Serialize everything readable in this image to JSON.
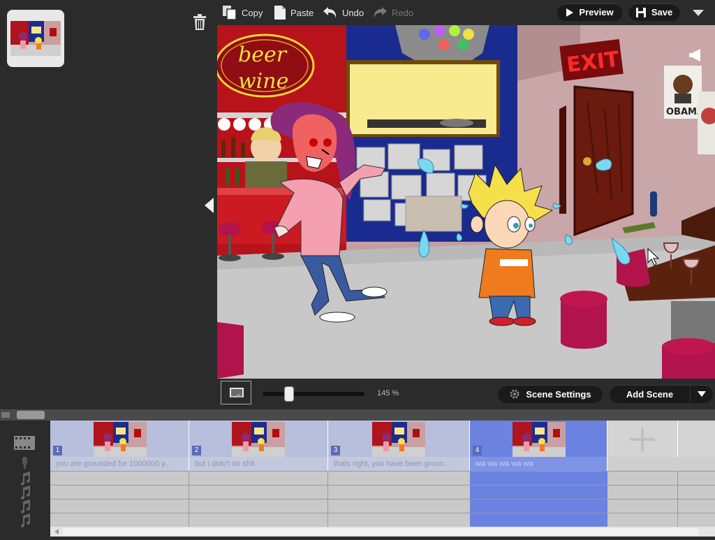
{
  "toolbar": {
    "copy_label": "Copy",
    "paste_label": "Paste",
    "undo_label": "Undo",
    "redo_label": "Redo",
    "preview_label": "Preview",
    "save_label": "Save"
  },
  "stage": {
    "bar_sign_line1": "beer",
    "bar_sign_line2": "wine",
    "exit_sign": "EXIT",
    "poster_text": "OBAMA"
  },
  "stagebar": {
    "zoom_label": "145 %",
    "zoom_level_fraction": 0.25,
    "scene_settings_label": "Scene Settings",
    "add_scene_label": "Add Scene"
  },
  "timeline": {
    "scenes": [
      {
        "number": "1",
        "caption": "you are grounded for 1000000 y...",
        "selected": false
      },
      {
        "number": "2",
        "caption": "but i didn't do shit",
        "selected": false
      },
      {
        "number": "3",
        "caption": "thats right, you have been groun...",
        "selected": false
      },
      {
        "number": "4",
        "caption": "wa wa wa wa wa",
        "selected": true
      }
    ],
    "track_icons": [
      "film-icon",
      "microphone-icon",
      "music-note-icon",
      "music-note-icon",
      "music-note-icon",
      "music-note-icon"
    ]
  },
  "colors": {
    "selected_scene": "#6b82e0",
    "scene_block": "#b7bfdc",
    "bar_red": "#c0121c",
    "wall": "#c9a6a8"
  }
}
